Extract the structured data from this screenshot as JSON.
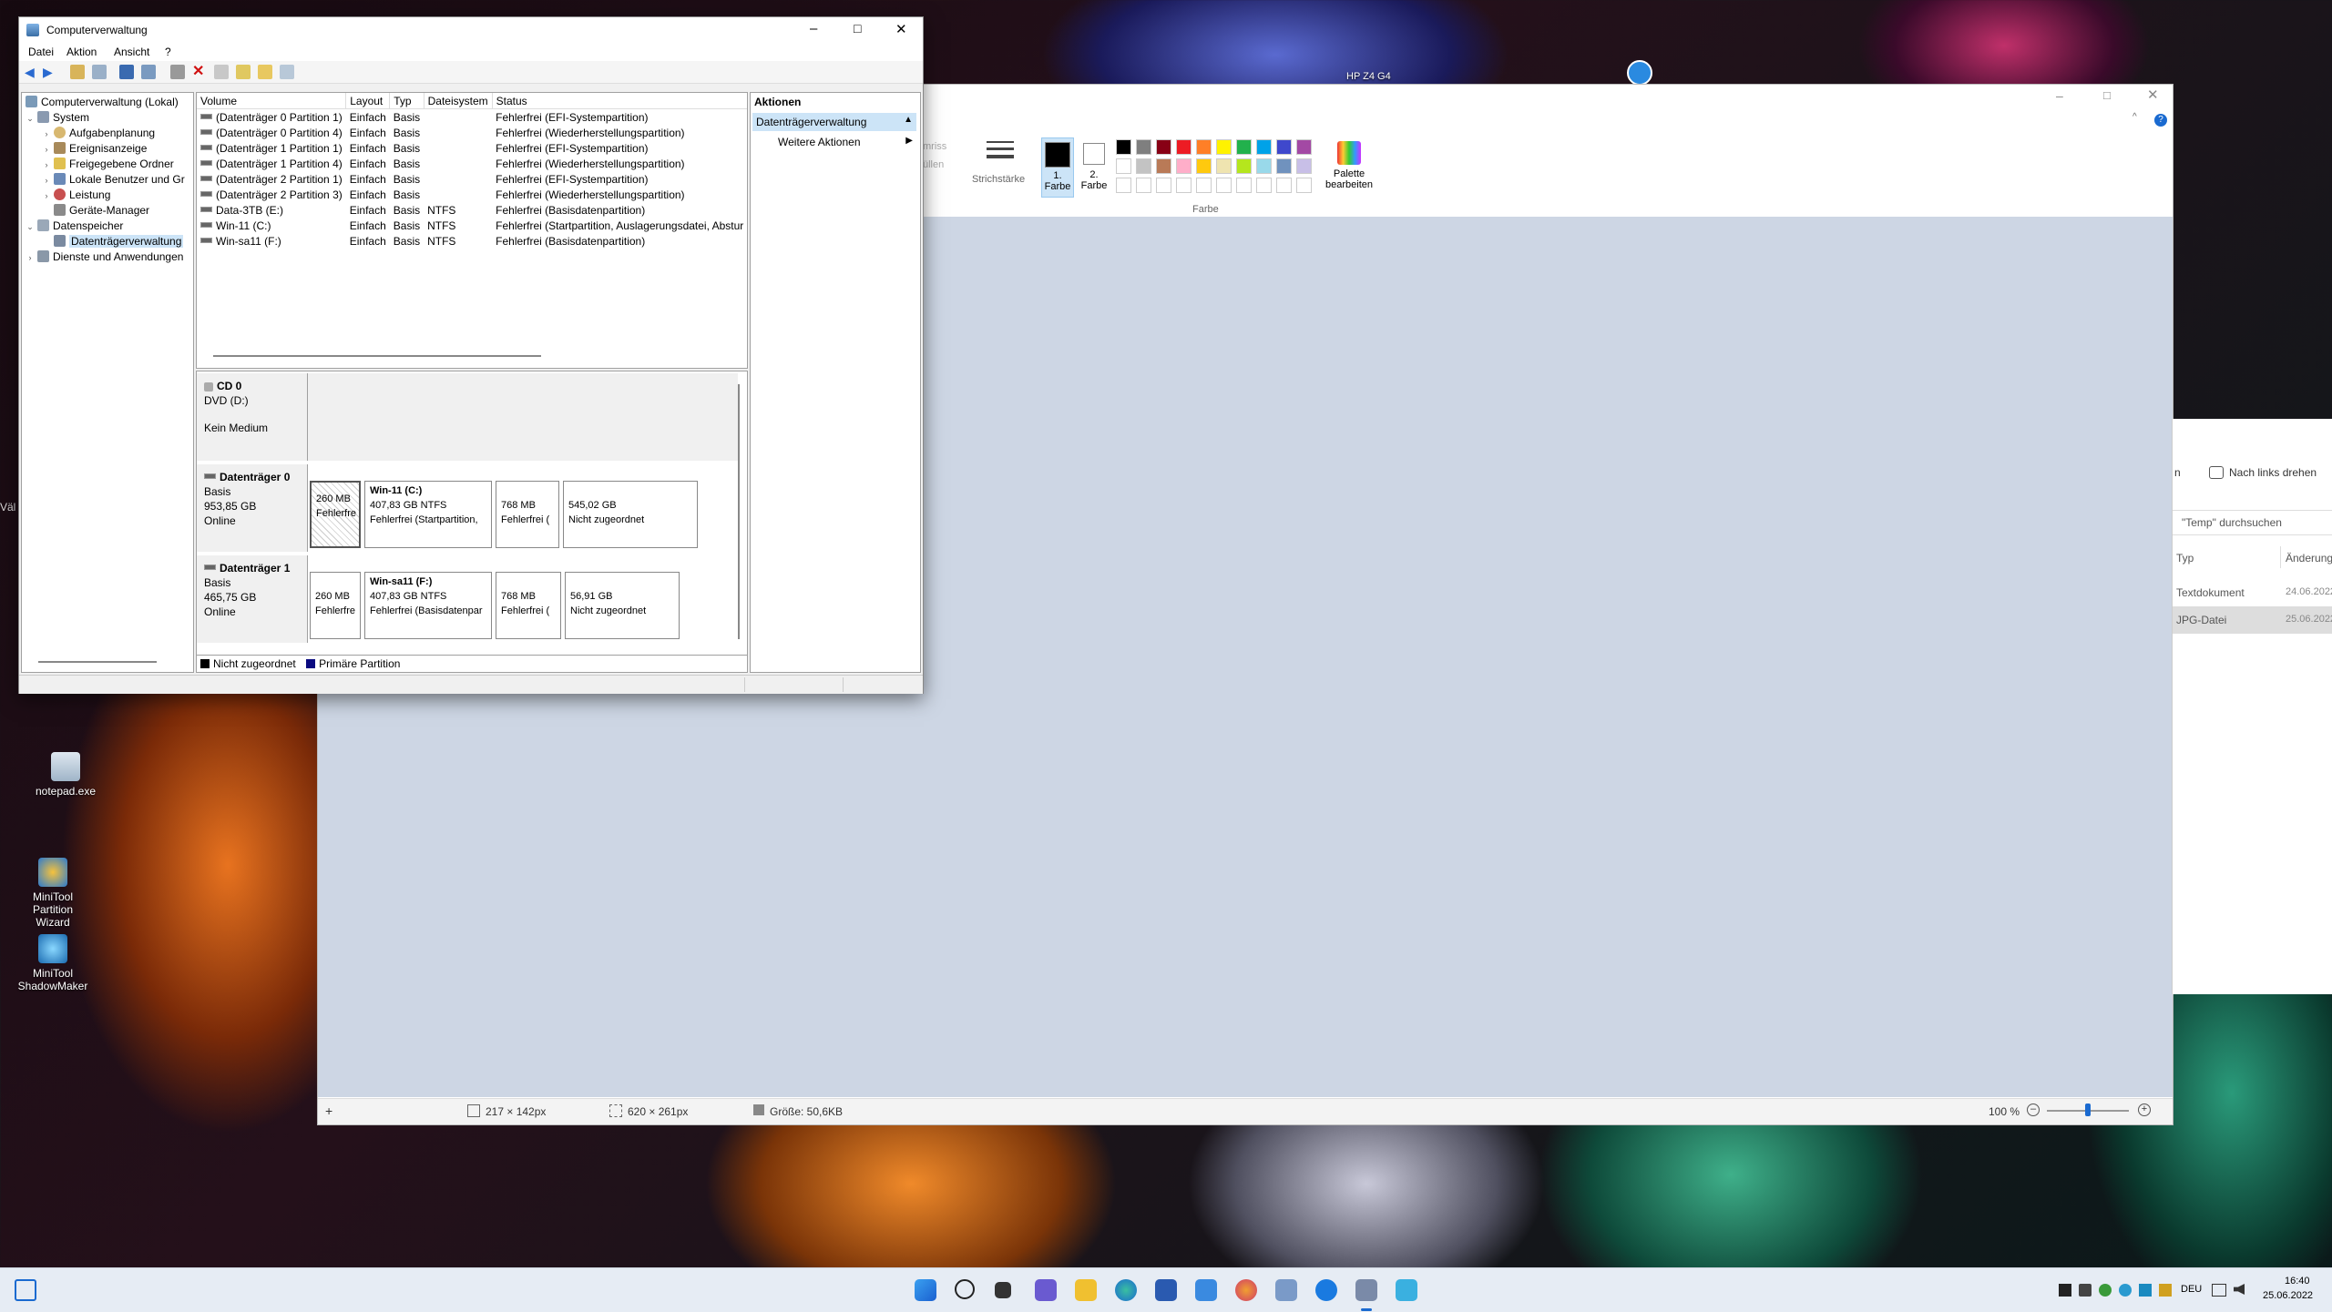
{
  "desktop": {
    "icons": [
      {
        "label": "notepad.exe"
      },
      {
        "label": "MiniTool Partition Wizard"
      },
      {
        "label": "MiniTool ShadowMaker"
      }
    ],
    "top_label": "HP Z4 G4",
    "left_edge_text": "Väl"
  },
  "paint": {
    "ribbon": {
      "umriss": "mriss",
      "fuellen": "üllen",
      "strichstaerke": "Strichstärke",
      "farbe1": "1. Farbe",
      "farbe2": "2. Farbe",
      "palette": "Palette bearbeiten",
      "group_farbe": "Farbe"
    },
    "palette_colors": [
      "#000000",
      "#7f7f7f",
      "#880015",
      "#ed1c24",
      "#ff7f27",
      "#fff200",
      "#22b14c",
      "#00a2e8",
      "#3f48cc",
      "#a349a4",
      "#ffffff",
      "#c3c3c3",
      "#b97a57",
      "#ffaec9",
      "#ffc90e",
      "#efe4b0",
      "#b5e61d",
      "#99d9ea",
      "#7092be",
      "#c8bfe7"
    ],
    "status": {
      "pos": "217 × 142px",
      "sel": "620 × 261px",
      "size": "Größe: 50,6KB",
      "zoom": "100 %"
    }
  },
  "explorer": {
    "rotate": "Nach links drehen",
    "prefix": "n",
    "search_placeholder": "\"Temp\" durchsuchen",
    "col_type": "Typ",
    "col_change": "Änderung",
    "rows": [
      {
        "type": "Textdokument",
        "date": "24.06.2022"
      },
      {
        "type": "JPG-Datei",
        "date": "25.06.2022"
      }
    ]
  },
  "cm": {
    "title": "Computerverwaltung",
    "menu": [
      "Datei",
      "Aktion",
      "Ansicht",
      "?"
    ],
    "tree": {
      "root": "Computerverwaltung (Lokal)",
      "system": "System",
      "aufgaben": "Aufgabenplanung",
      "ereignis": "Ereignisanzeige",
      "freigegeben": "Freigegebene Ordner",
      "lokale": "Lokale Benutzer und Gr",
      "leistung": "Leistung",
      "geraete": "Geräte-Manager",
      "datenspeicher": "Datenspeicher",
      "datentraeger": "Datenträgerverwaltung",
      "dienste": "Dienste und Anwendungen"
    },
    "columns": [
      "Volume",
      "Layout",
      "Typ",
      "Dateisystem",
      "Status"
    ],
    "volumes": [
      [
        "(Datenträger 0 Partition 1)",
        "Einfach",
        "Basis",
        "",
        "Fehlerfrei (EFI-Systempartition)"
      ],
      [
        "(Datenträger 0 Partition 4)",
        "Einfach",
        "Basis",
        "",
        "Fehlerfrei (Wiederherstellungspartition)"
      ],
      [
        "(Datenträger 1 Partition 1)",
        "Einfach",
        "Basis",
        "",
        "Fehlerfrei (EFI-Systempartition)"
      ],
      [
        "(Datenträger 1 Partition 4)",
        "Einfach",
        "Basis",
        "",
        "Fehlerfrei (Wiederherstellungspartition)"
      ],
      [
        "(Datenträger 2 Partition 1)",
        "Einfach",
        "Basis",
        "",
        "Fehlerfrei (EFI-Systempartition)"
      ],
      [
        "(Datenträger 2 Partition 3)",
        "Einfach",
        "Basis",
        "",
        "Fehlerfrei (Wiederherstellungspartition)"
      ],
      [
        "Data-3TB (E:)",
        "Einfach",
        "Basis",
        "NTFS",
        "Fehlerfrei (Basisdatenpartition)"
      ],
      [
        "Win-11 (C:)",
        "Einfach",
        "Basis",
        "NTFS",
        "Fehlerfrei (Startpartition, Auslagerungsdatei, Abstur"
      ],
      [
        "Win-sa11 (F:)",
        "Einfach",
        "Basis",
        "NTFS",
        "Fehlerfrei (Basisdatenpartition)"
      ]
    ],
    "disks": {
      "cd0": {
        "name": "CD 0",
        "type": "DVD (D:)",
        "media": "Kein Medium"
      },
      "d0": {
        "name": "Datenträger 0",
        "type": "Basis",
        "size": "953,85 GB",
        "state": "Online",
        "p1": {
          "size": "260 MB",
          "status": "Fehlerfre"
        },
        "p2": {
          "name": "Win-11   (C:)",
          "size": "407,83 GB NTFS",
          "status": "Fehlerfrei (Startpartition,"
        },
        "p3": {
          "size": "768 MB",
          "status": "Fehlerfrei ("
        },
        "p4": {
          "size": "545,02 GB",
          "status": "Nicht zugeordnet"
        }
      },
      "d1": {
        "name": "Datenträger 1",
        "type": "Basis",
        "size": "465,75 GB",
        "state": "Online",
        "p1": {
          "size": "260 MB",
          "status": "Fehlerfre"
        },
        "p2": {
          "name": "Win-sa11   (F:)",
          "size": "407,83 GB NTFS",
          "status": "Fehlerfrei (Basisdatenpar"
        },
        "p3": {
          "size": "768 MB",
          "status": "Fehlerfrei ("
        },
        "p4": {
          "size": "56,91 GB",
          "status": "Nicht zugeordnet"
        }
      }
    },
    "legend": {
      "unallocated": "Nicht zugeordnet",
      "primary": "Primäre Partition"
    },
    "actions": {
      "header": "Aktionen",
      "section": "Datenträgerverwaltung",
      "more": "Weitere Aktionen"
    }
  },
  "taskbar": {
    "lang": "DEU",
    "time": "16:40",
    "date": "25.06.2022"
  }
}
